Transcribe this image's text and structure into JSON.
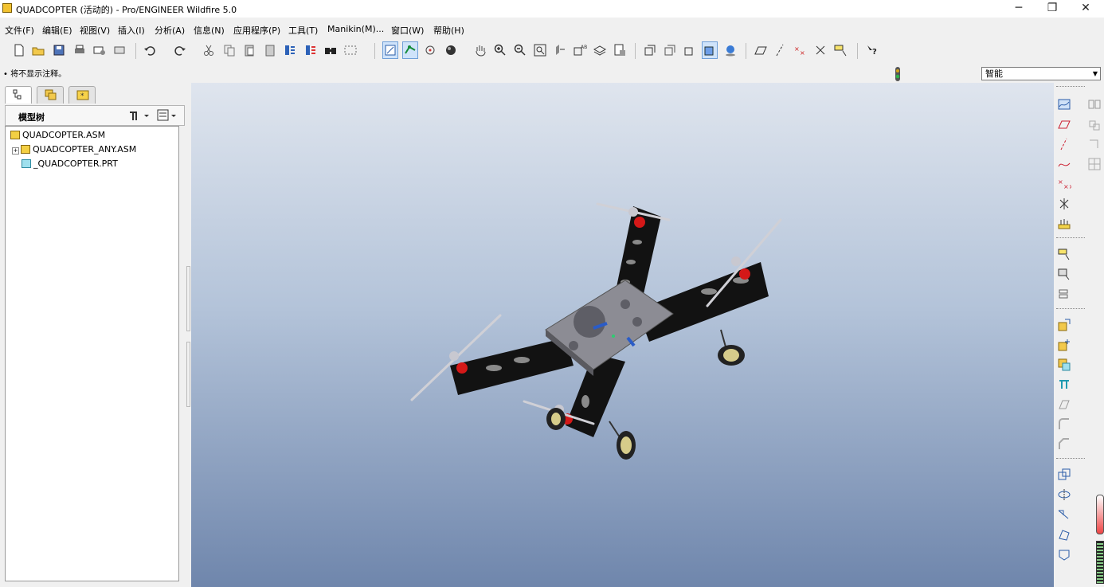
{
  "window": {
    "title": "QUADCOPTER (活动的) - Pro/ENGINEER Wildfire 5.0",
    "minimize": "─",
    "restore": "❐",
    "close": "✕"
  },
  "menu": [
    "文件(F)",
    "编辑(E)",
    "视图(V)",
    "插入(I)",
    "分析(A)",
    "信息(N)",
    "应用程序(P)",
    "工具(T)",
    "Manikin(M)...",
    "窗口(W)",
    "帮助(H)"
  ],
  "status": {
    "message": "• 将不显示注释。"
  },
  "filter": {
    "value": "智能"
  },
  "model_tree": {
    "header": "模型树",
    "items": [
      {
        "label": "QUADCOPTER.ASM",
        "type": "asm"
      },
      {
        "label": "QUADCOPTER_ANY.ASM",
        "type": "asm",
        "expander": "+"
      },
      {
        "label": "_QUADCOPTER.PRT",
        "type": "prt"
      }
    ]
  },
  "colors": {
    "viewport_top": "#dfe5ee",
    "viewport_bottom": "#6f86ac",
    "asm_icon": "#f3cf43",
    "prt_icon": "#9fe0ee"
  }
}
